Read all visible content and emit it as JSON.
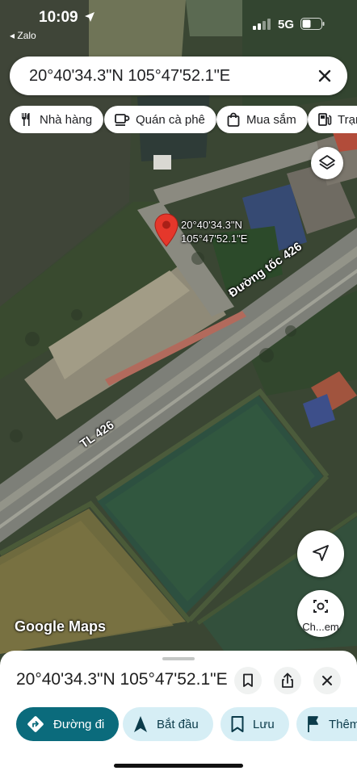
{
  "status_bar": {
    "time": "10:09",
    "back_app": "◂ Zalo",
    "network": "5G"
  },
  "search": {
    "query": "20°40'34.3\"N 105°47'52.1\"E"
  },
  "chips": [
    {
      "label": "Nhà hàng",
      "icon": "fork-knife-icon"
    },
    {
      "label": "Quán cà phê",
      "icon": "coffee-cup-icon"
    },
    {
      "label": "Mua sắm",
      "icon": "shopping-bag-icon"
    },
    {
      "label": "Trạm",
      "icon": "gas-station-icon"
    }
  ],
  "map": {
    "pin_label_line1": "20°40'34.3\"N",
    "pin_label_line2": "105°47'52.1\"E",
    "road_label_1": "Đường tốc 426",
    "road_label_2": "TL 426",
    "attribution": "Google Maps",
    "pin_color": "#e5372b",
    "lens_button_label": "Ch...em"
  },
  "sheet": {
    "title": "20°40'34.3\"N 105°47'52.1\"E",
    "actions": [
      {
        "label": "Đường đi",
        "icon": "directions-icon",
        "primary": true
      },
      {
        "label": "Bắt đầu",
        "icon": "navigation-arrow-icon",
        "primary": false
      },
      {
        "label": "Lưu",
        "icon": "bookmark-icon",
        "primary": false
      },
      {
        "label": "Thêm",
        "icon": "flag-icon",
        "primary": false
      }
    ],
    "accent_color": "#0b6b7c"
  }
}
